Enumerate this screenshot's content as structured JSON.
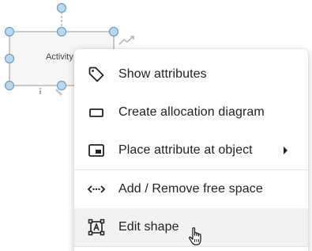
{
  "canvas": {
    "shape_label": "Activity"
  },
  "context_menu": {
    "items": [
      {
        "label": "Show attributes",
        "icon": "tag-icon"
      },
      {
        "label": "Create allocation diagram",
        "icon": "rectangle-outline-icon"
      },
      {
        "label": "Place attribute at object",
        "icon": "picture-in-picture-icon",
        "submenu": true
      },
      {
        "label": "Add / Remove free space",
        "icon": "free-space-arrows-icon"
      },
      {
        "label": "Edit shape",
        "icon": "edit-shape-icon",
        "hovered": true
      }
    ]
  },
  "colors": {
    "handle_fill": "#b9d7ee",
    "handle_stroke": "#6f9fc0",
    "hover_bg": "#f2f2f2"
  }
}
